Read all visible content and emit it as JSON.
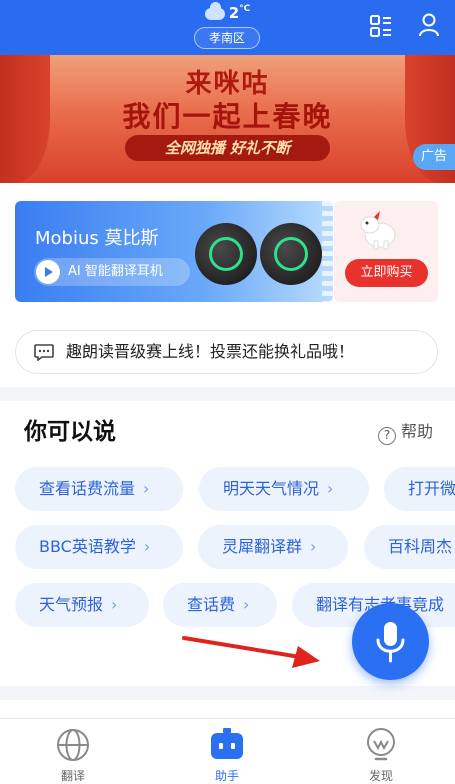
{
  "header": {
    "temperature": "2",
    "temp_unit": "°C",
    "location": "孝南区",
    "icons": [
      "weather-cloud-icon",
      "grid-menu-icon",
      "user-icon"
    ]
  },
  "banner": {
    "line1": "来咪咕",
    "line2": "我们一起上春晚",
    "tagline": "全网独播 好礼不断",
    "ad_label": "广告"
  },
  "promo": {
    "title": "Mobius 莫比斯",
    "subtitle": "AI 智能翻译耳机",
    "buy_label": "立即购买"
  },
  "notice": {
    "text": "趣朗读晋级赛上线！投票还能换礼品哦！"
  },
  "suggestions": {
    "title": "你可以说",
    "help_label": "帮助",
    "row1": [
      "查看话费流量",
      "明天天气情况",
      "打开微"
    ],
    "row2": [
      "BBC英语教学",
      "灵犀翻译群",
      "百科周杰"
    ],
    "row3": [
      "天气预报",
      "查话费",
      "翻译有志者事竟成"
    ]
  },
  "nav": {
    "items": [
      {
        "label": "翻译",
        "icon": "globe-icon"
      },
      {
        "label": "助手",
        "icon": "robot-icon"
      },
      {
        "label": "发现",
        "icon": "bulb-icon"
      }
    ],
    "active_index": 1
  },
  "colors": {
    "primary": "#2b6ff2",
    "chip_bg": "#edf3fd",
    "chip_text": "#2d63d8",
    "buy_button": "#e8322e",
    "arrow": "#e0241b"
  }
}
